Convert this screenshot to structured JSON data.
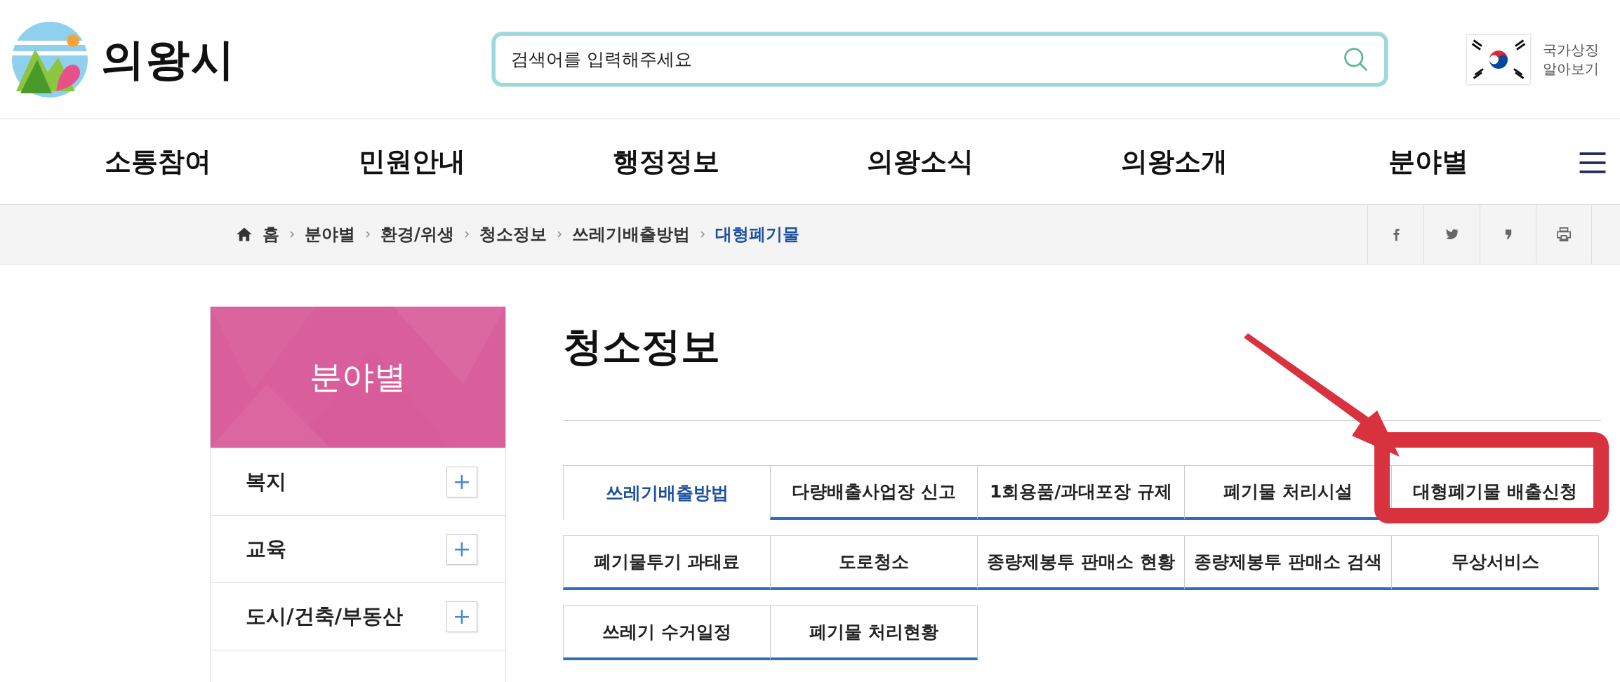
{
  "header": {
    "logo_text": "의왕시",
    "search": {
      "placeholder": "검색어를 입력해주세요"
    },
    "symbol_link": "국가상징 알아보기"
  },
  "nav": {
    "items": [
      "소통참여",
      "민원안내",
      "행정정보",
      "의왕소식",
      "의왕소개",
      "분야별"
    ]
  },
  "breadcrumb": {
    "items": [
      {
        "label": "홈",
        "selected": false
      },
      {
        "label": "분야별",
        "selected": false
      },
      {
        "label": "환경/위생",
        "selected": false
      },
      {
        "label": "청소정보",
        "selected": false
      },
      {
        "label": "쓰레기배출방법",
        "selected": false
      },
      {
        "label": "대형폐기물",
        "selected": true
      }
    ]
  },
  "sidebar": {
    "title": "분야별",
    "items": [
      {
        "label": "복지",
        "expanded": false
      },
      {
        "label": "교육",
        "expanded": false
      },
      {
        "label": "도시/건축/부동산",
        "expanded": false
      }
    ]
  },
  "content": {
    "title": "청소정보",
    "tab_rows": [
      [
        {
          "label": "쓰레기배출방법",
          "selected": true
        },
        {
          "label": "다량배출사업장 신고",
          "selected": false
        },
        {
          "label": "1회용품/과대포장 규제",
          "selected": false
        },
        {
          "label": "폐기물 처리시설",
          "selected": false
        },
        {
          "label": "대형폐기물 배출신청",
          "selected": false
        }
      ],
      [
        {
          "label": "폐기물투기 과태료",
          "selected": false
        },
        {
          "label": "도로청소",
          "selected": false
        },
        {
          "label": "종량제봉투 판매소 현황",
          "selected": false
        },
        {
          "label": "종량제봉투 판매소 검색",
          "selected": false
        },
        {
          "label": "무상서비스",
          "selected": false
        }
      ],
      [
        {
          "label": "쓰레기 수거일정",
          "selected": false
        },
        {
          "label": "폐기물 처리현황",
          "selected": false
        }
      ]
    ]
  }
}
